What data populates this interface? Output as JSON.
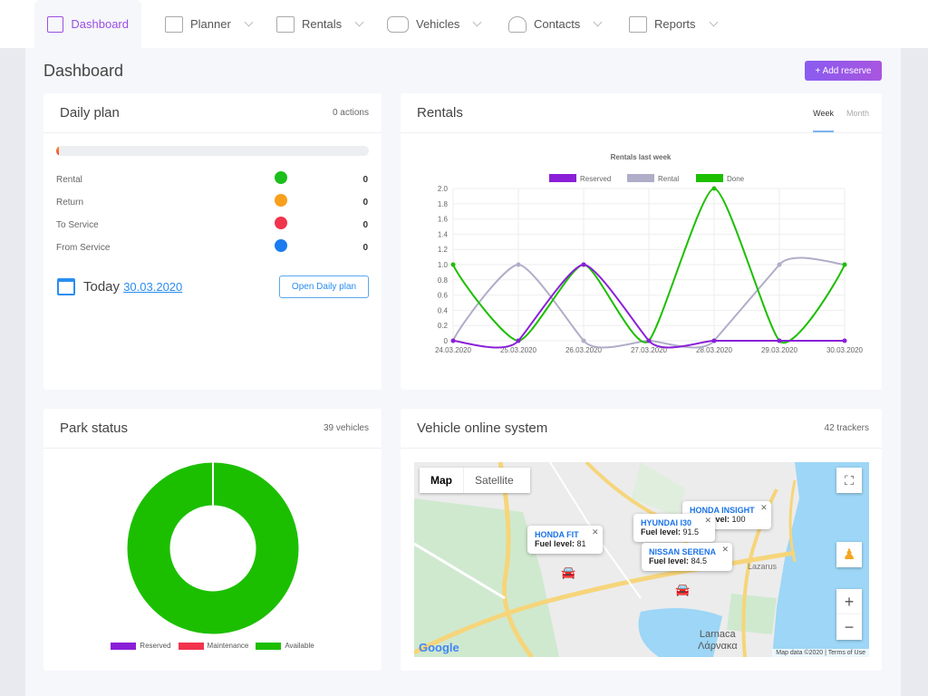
{
  "nav": {
    "items": [
      {
        "label": "Dashboard",
        "icon": "dashboard-icon",
        "active": true
      },
      {
        "label": "Planner",
        "icon": "planner-icon"
      },
      {
        "label": "Rentals",
        "icon": "rentals-icon"
      },
      {
        "label": "Vehicles",
        "icon": "car-icon"
      },
      {
        "label": "Contacts",
        "icon": "contacts-icon"
      },
      {
        "label": "Reports",
        "icon": "reports-icon"
      }
    ]
  },
  "page": {
    "title": "Dashboard",
    "add_button": "+ Add reserve"
  },
  "daily_plan": {
    "title": "Daily plan",
    "summary": "0 actions",
    "progress": 0,
    "rows": [
      {
        "label": "Rental",
        "color": "#1cbf1c",
        "value": "0"
      },
      {
        "label": "Return",
        "color": "#f8a01b",
        "value": "0"
      },
      {
        "label": "To Service",
        "color": "#f2334d",
        "value": "0"
      },
      {
        "label": "From Service",
        "color": "#1a7cf0",
        "value": "0"
      }
    ],
    "today_label": "Today",
    "today_date": "30.03.2020",
    "open_button": "Open Daily plan"
  },
  "rentals": {
    "title": "Rentals",
    "tabs": [
      "Week",
      "Month"
    ],
    "active_tab": "Week"
  },
  "chart_data": {
    "type": "line",
    "title": "Rentals last week",
    "legend_position": "top",
    "grid": true,
    "categories": [
      "24.03.2020",
      "25.03.2020",
      "26.03.2020",
      "27.03.2020",
      "28.03.2020",
      "29.03.2020",
      "30.03.2020"
    ],
    "ylim": [
      0,
      2
    ],
    "yticks": [
      "0",
      "0.2",
      "0.4",
      "0.6",
      "0.8",
      "1.0",
      "1.2",
      "1.4",
      "1.6",
      "1.8",
      "2.0"
    ],
    "series": [
      {
        "name": "Reserved",
        "color": "#8a1fd8",
        "values": [
          0,
          0,
          1,
          0,
          0,
          0,
          0
        ]
      },
      {
        "name": "Rental",
        "color": "#b0adc8",
        "values": [
          0,
          1,
          0,
          0,
          0,
          1,
          1
        ]
      },
      {
        "name": "Done",
        "color": "#1cbf00",
        "values": [
          1,
          0,
          1,
          0,
          2,
          0,
          1
        ]
      }
    ]
  },
  "park": {
    "title": "Park status",
    "summary": "39 vehicles",
    "legend": [
      {
        "label": "Reserved",
        "color": "#8a1fd8",
        "value": 0
      },
      {
        "label": "Maintenance",
        "color": "#f2334d",
        "value": 0
      },
      {
        "label": "Available",
        "color": "#1cbf00",
        "value": 39
      }
    ]
  },
  "vos": {
    "title": "Vehicle online system",
    "summary": "42 trackers",
    "map_tabs": [
      "Map",
      "Satellite"
    ],
    "active_map_tab": "Map",
    "popups": [
      {
        "name": "HONDA FIT",
        "fuel_label": "Fuel level:",
        "fuel": "81"
      },
      {
        "name": "HONDA INSIGHT",
        "fuel_label": "Fuel level:",
        "fuel": "100"
      },
      {
        "name": "HYUNDAI I30",
        "fuel_label": "Fuel level:",
        "fuel": "91.5"
      },
      {
        "name": "NISSAN SERENA",
        "fuel_label": "Fuel level:",
        "fuel": "84.5"
      }
    ],
    "place": "Larnaca",
    "place_local": "Λάρνακα",
    "poi": "Lazarus",
    "attribution": "Map data ©2020",
    "terms": "Terms of Use",
    "logo": "Google",
    "zoom_in": "+",
    "zoom_out": "−"
  }
}
